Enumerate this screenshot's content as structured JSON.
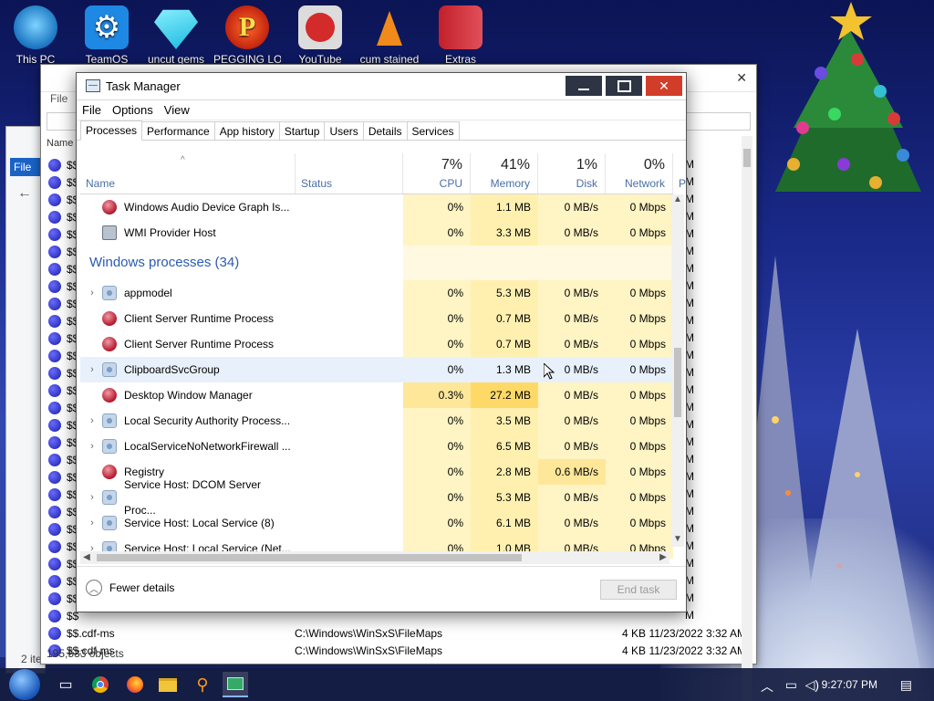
{
  "desktop": {
    "icons": [
      {
        "label": "This PC"
      },
      {
        "label": "TeamOS"
      },
      {
        "label": "uncut gems"
      },
      {
        "label": "PEGGING LOL"
      },
      {
        "label": "YouTube"
      },
      {
        "label": "cum stained"
      },
      {
        "label": "Extras"
      }
    ]
  },
  "explorer": {
    "menu_file": "File",
    "name_header": "Name",
    "row_name": "$$",
    "row_name_last2": "$$.cdf-ms",
    "row_name_last": "$$.cdf-ms",
    "row_path": "C:\\Windows\\WinSxS\\FileMaps",
    "row_size": "4 KB",
    "row_date": "11/23/2022 3:32 AM",
    "right_m": "M",
    "status_objects": "195,533 objects",
    "side_file": "File",
    "side_status": "2 ite"
  },
  "task_manager": {
    "title": "Task Manager",
    "menu": [
      "File",
      "Options",
      "View"
    ],
    "tabs": [
      "Processes",
      "Performance",
      "App history",
      "Startup",
      "Users",
      "Details",
      "Services"
    ],
    "columns": {
      "name": "Name",
      "status": "Status",
      "cpu": {
        "pct": "7%",
        "label": "CPU"
      },
      "memory": {
        "pct": "41%",
        "label": "Memory"
      },
      "disk": {
        "pct": "1%",
        "label": "Disk"
      },
      "network": {
        "pct": "0%",
        "label": "Network"
      },
      "power": "P"
    },
    "top_rows": [
      {
        "name": "Windows Audio Device Graph Is...",
        "cpu": "0%",
        "mem": "1.1 MB",
        "disk": "0 MB/s",
        "net": "0 Mbps",
        "icon": "process-ball-icon"
      },
      {
        "name": "WMI Provider Host",
        "cpu": "0%",
        "mem": "3.3 MB",
        "disk": "0 MB/s",
        "net": "0 Mbps",
        "icon": "wmi-icon"
      }
    ],
    "group_label": "Windows processes (34)",
    "win_rows": [
      {
        "name": "appmodel",
        "expand": true,
        "icon": "service-gear-icon",
        "cpu": "0%",
        "mem": "5.3 MB",
        "disk": "0 MB/s",
        "net": "0 Mbps"
      },
      {
        "name": "Client Server Runtime Process",
        "expand": false,
        "icon": "process-ball-icon",
        "cpu": "0%",
        "mem": "0.7 MB",
        "disk": "0 MB/s",
        "net": "0 Mbps"
      },
      {
        "name": "Client Server Runtime Process",
        "expand": false,
        "icon": "process-ball-icon",
        "cpu": "0%",
        "mem": "0.7 MB",
        "disk": "0 MB/s",
        "net": "0 Mbps"
      },
      {
        "name": "ClipboardSvcGroup",
        "expand": true,
        "icon": "service-gear-icon",
        "cpu": "0%",
        "mem": "1.3 MB",
        "disk": "0 MB/s",
        "net": "0 Mbps",
        "hover": true
      },
      {
        "name": "Desktop Window Manager",
        "expand": false,
        "icon": "process-ball-icon",
        "cpu": "0.3%",
        "mem": "27.2 MB",
        "disk": "0 MB/s",
        "net": "0 Mbps",
        "hot_cpu": true,
        "hot_mem": true
      },
      {
        "name": "Local Security Authority Process...",
        "expand": true,
        "icon": "service-gear-icon",
        "cpu": "0%",
        "mem": "3.5 MB",
        "disk": "0 MB/s",
        "net": "0 Mbps"
      },
      {
        "name": "LocalServiceNoNetworkFirewall ...",
        "expand": true,
        "icon": "service-gear-icon",
        "cpu": "0%",
        "mem": "6.5 MB",
        "disk": "0 MB/s",
        "net": "0 Mbps"
      },
      {
        "name": "Registry",
        "expand": false,
        "icon": "process-ball-icon",
        "cpu": "0%",
        "mem": "2.8 MB",
        "disk": "0.6 MB/s",
        "net": "0 Mbps",
        "hot_disk": true
      },
      {
        "name": "Service Host: DCOM Server Proc...",
        "expand": true,
        "icon": "service-gear-icon",
        "cpu": "0%",
        "mem": "5.3 MB",
        "disk": "0 MB/s",
        "net": "0 Mbps"
      },
      {
        "name": "Service Host: Local Service (8)",
        "expand": true,
        "icon": "service-gear-icon",
        "cpu": "0%",
        "mem": "6.1 MB",
        "disk": "0 MB/s",
        "net": "0 Mbps"
      },
      {
        "name": "Service Host: Local Service (Net...",
        "expand": true,
        "icon": "service-gear-icon",
        "cpu": "0%",
        "mem": "1.0 MB",
        "disk": "0 MB/s",
        "net": "0 Mbps"
      }
    ],
    "footer": {
      "fewer_details": "Fewer details",
      "end_task": "End task"
    }
  },
  "taskbar": {
    "clock": "9:27:07 PM"
  }
}
